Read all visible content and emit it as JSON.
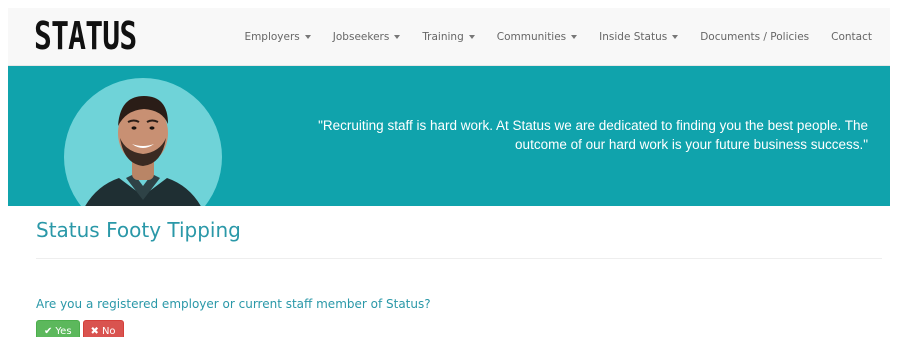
{
  "brand": {
    "logo_text": "STATUS"
  },
  "nav": {
    "items": [
      {
        "label": "Employers",
        "dropdown": true
      },
      {
        "label": "Jobseekers",
        "dropdown": true
      },
      {
        "label": "Training",
        "dropdown": true
      },
      {
        "label": "Communities",
        "dropdown": true
      },
      {
        "label": "Inside Status",
        "dropdown": true
      },
      {
        "label": "Documents / Policies",
        "dropdown": false
      },
      {
        "label": "Contact",
        "dropdown": false
      }
    ]
  },
  "banner": {
    "quote": "\"Recruiting staff is hard work. At Status we are dedicated to finding you the best people. The outcome of our hard work is your future business success.\"",
    "background_color": "#10a3ac",
    "portrait_circle_color": "#6fd3d8"
  },
  "main": {
    "title": "Status Footy Tipping",
    "question": "Are you a registered employer or current staff member of Status?",
    "yes_button": {
      "label": "Yes",
      "icon": "check-icon",
      "color": "#5cb85c"
    },
    "no_button": {
      "label": "No",
      "icon": "x-icon",
      "color": "#d9534f"
    }
  },
  "colors": {
    "accent": "#2a98a8"
  }
}
